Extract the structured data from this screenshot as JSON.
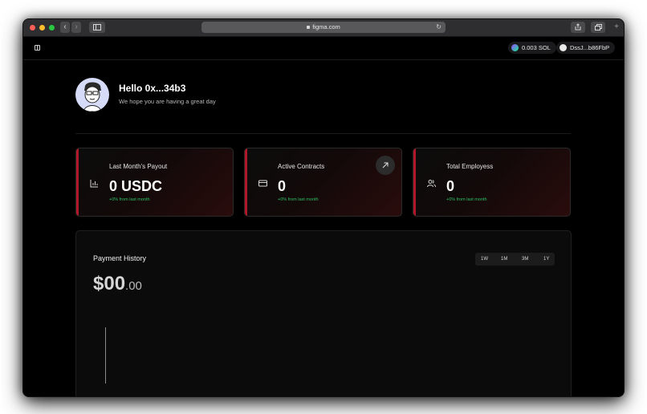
{
  "browser": {
    "url": "figma.com",
    "traffic_lights": [
      "#ff5f57",
      "#febc2e",
      "#28c840"
    ]
  },
  "topbar": {
    "balance": "0.003 SOL",
    "wallet": "DssJ...b86FbP"
  },
  "greeting": {
    "title": "Hello 0x...34b3",
    "subtitle": "We hope you are having a great day"
  },
  "stats": [
    {
      "title": "Last Month's Payout",
      "value": "0 USDC",
      "delta": "+0% from last month",
      "icon": "bar-chart-icon"
    },
    {
      "title": "Active Contracts",
      "value": "0",
      "delta": "+0% from last month",
      "icon": "credit-card-icon"
    },
    {
      "title": "Total Employess",
      "value": "0",
      "delta": "+0% from last month",
      "icon": "users-icon"
    }
  ],
  "payment_history": {
    "title": "Payment History",
    "amount_main": "$00",
    "amount_cents": ".00",
    "ranges": [
      "1W",
      "1M",
      "3M",
      "1Y"
    ]
  },
  "colors": {
    "accent": "#b0182a",
    "positive": "#2fbf63",
    "background": "#000000"
  }
}
